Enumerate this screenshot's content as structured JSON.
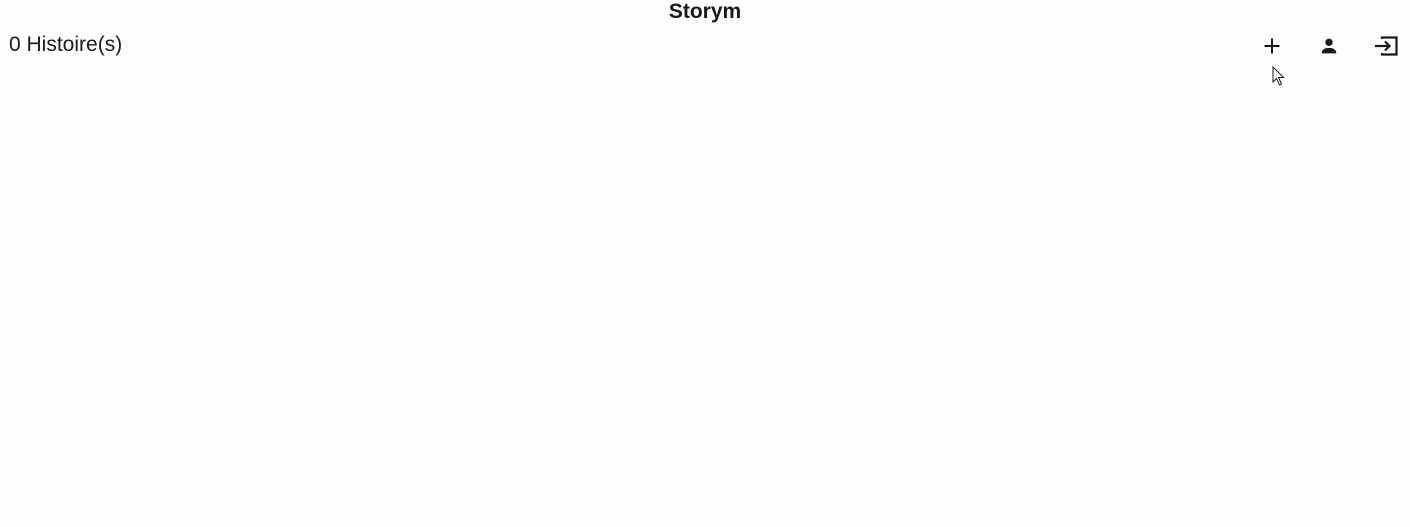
{
  "header": {
    "title": "Storym"
  },
  "main": {
    "story_count": "0 Histoire(s)"
  },
  "toolbar": {
    "icons": [
      "plus-icon",
      "person-icon",
      "logout-icon"
    ]
  },
  "colors": {
    "background": "#fdfdfd",
    "text": "#1a1a1a",
    "icon": "#1a1a1a"
  }
}
